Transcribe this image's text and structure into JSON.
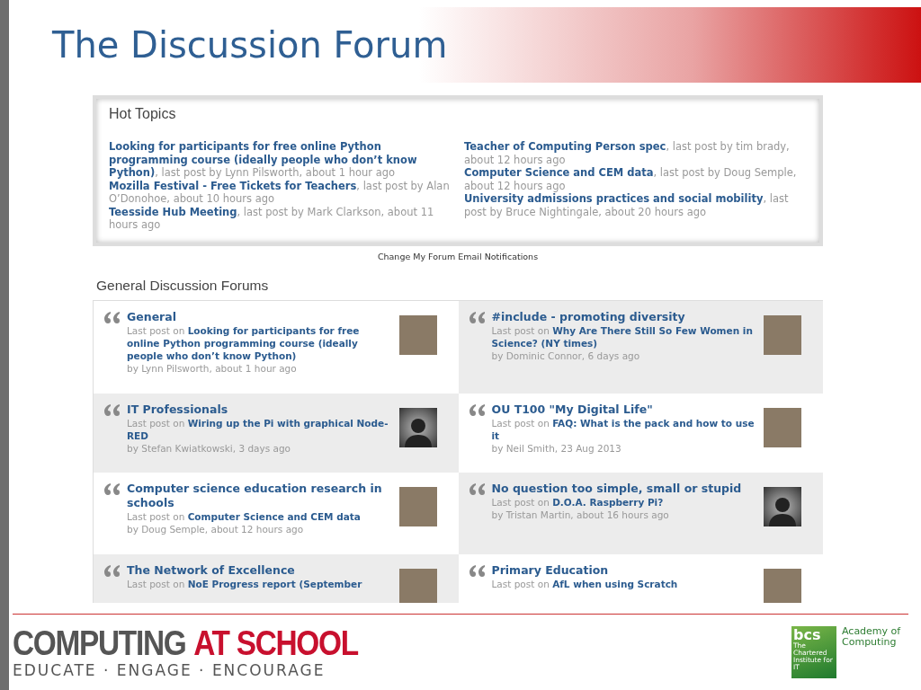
{
  "slide_title": "The Discussion Forum",
  "hot_topics": {
    "heading": "Hot Topics",
    "columns": [
      [
        {
          "text": "**Looking for participants for free online Python programming course (ideally people who don’t know Python)**, last post by Lynn Pilsworth, about 1 hour ago"
        },
        {
          "text": "**Mozilla Festival - Free Tickets for Teachers**, last post by Alan O’Donohoe, about 10 hours ago"
        },
        {
          "text": "**Teesside Hub Meeting**, last post by Mark Clarkson, about 11 hours ago"
        }
      ],
      [
        {
          "text": "**Teacher of Computing Person spec**, last post by tim brady, about 12 hours ago"
        },
        {
          "text": "**Computer Science and CEM data**, last post by Doug Semple, about 12 hours ago"
        },
        {
          "text": "**University admissions practices and social mobility**, last post by Bruce Nightingale, about 20 hours ago"
        }
      ]
    ]
  },
  "notifications_link": "Change My Forum Email Notifications",
  "forums": {
    "heading": "General Discussion Forums",
    "items": [
      {
        "name": "General",
        "last_post": "Last post on **Looking for participants for free online Python programming course (ideally people who don’t know Python)**",
        "by": "by Lynn Pilsworth, about 1 hour ago",
        "kind": "photo"
      },
      {
        "name": "#include - promoting diversity",
        "last_post": "Last post on **Why Are There Still So Few Women in Science? (NY times)**",
        "by": "by Dominic Connor, 6 days ago",
        "kind": "photo"
      },
      {
        "name": "IT Professionals",
        "last_post": "Last post on **Wiring up the Pi with graphical Node-RED**",
        "by": "by Stefan Kwiatkowski, 3 days ago",
        "kind": "silhouette"
      },
      {
        "name": "OU T100 \"My Digital Life\"",
        "last_post": "Last post on **FAQ: What is the pack and how to use it**",
        "by": "by Neil Smith, 23 Aug 2013",
        "kind": "photo"
      },
      {
        "name": "Computer science education research in schools",
        "last_post": "Last post on **Computer Science and CEM data**",
        "by": "by Doug Semple, about 12 hours ago",
        "kind": "photo"
      },
      {
        "name": "No question too simple, small or stupid",
        "last_post": "Last post on **D.O.A. Raspberry Pi?**",
        "by": "by Tristan Martin, about 16 hours ago",
        "kind": "silhouette"
      },
      {
        "name": "The Network of Excellence",
        "last_post": "Last post on **NoE Progress report (September**",
        "kind": "photo"
      },
      {
        "name": "Primary Education",
        "last_post": "Last post on **AfL when using Scratch**",
        "kind": "photo"
      }
    ]
  },
  "footer": {
    "logo_main": "COMPUTING",
    "logo_accent": "AT SCHOOL",
    "tagline": "EDUCATE · ENGAGE · ENCOURAGE",
    "bcs_mark": "bcs",
    "bcs_sub": "The Chartered Institute for IT",
    "bcs_name": "Academy of Computing"
  }
}
